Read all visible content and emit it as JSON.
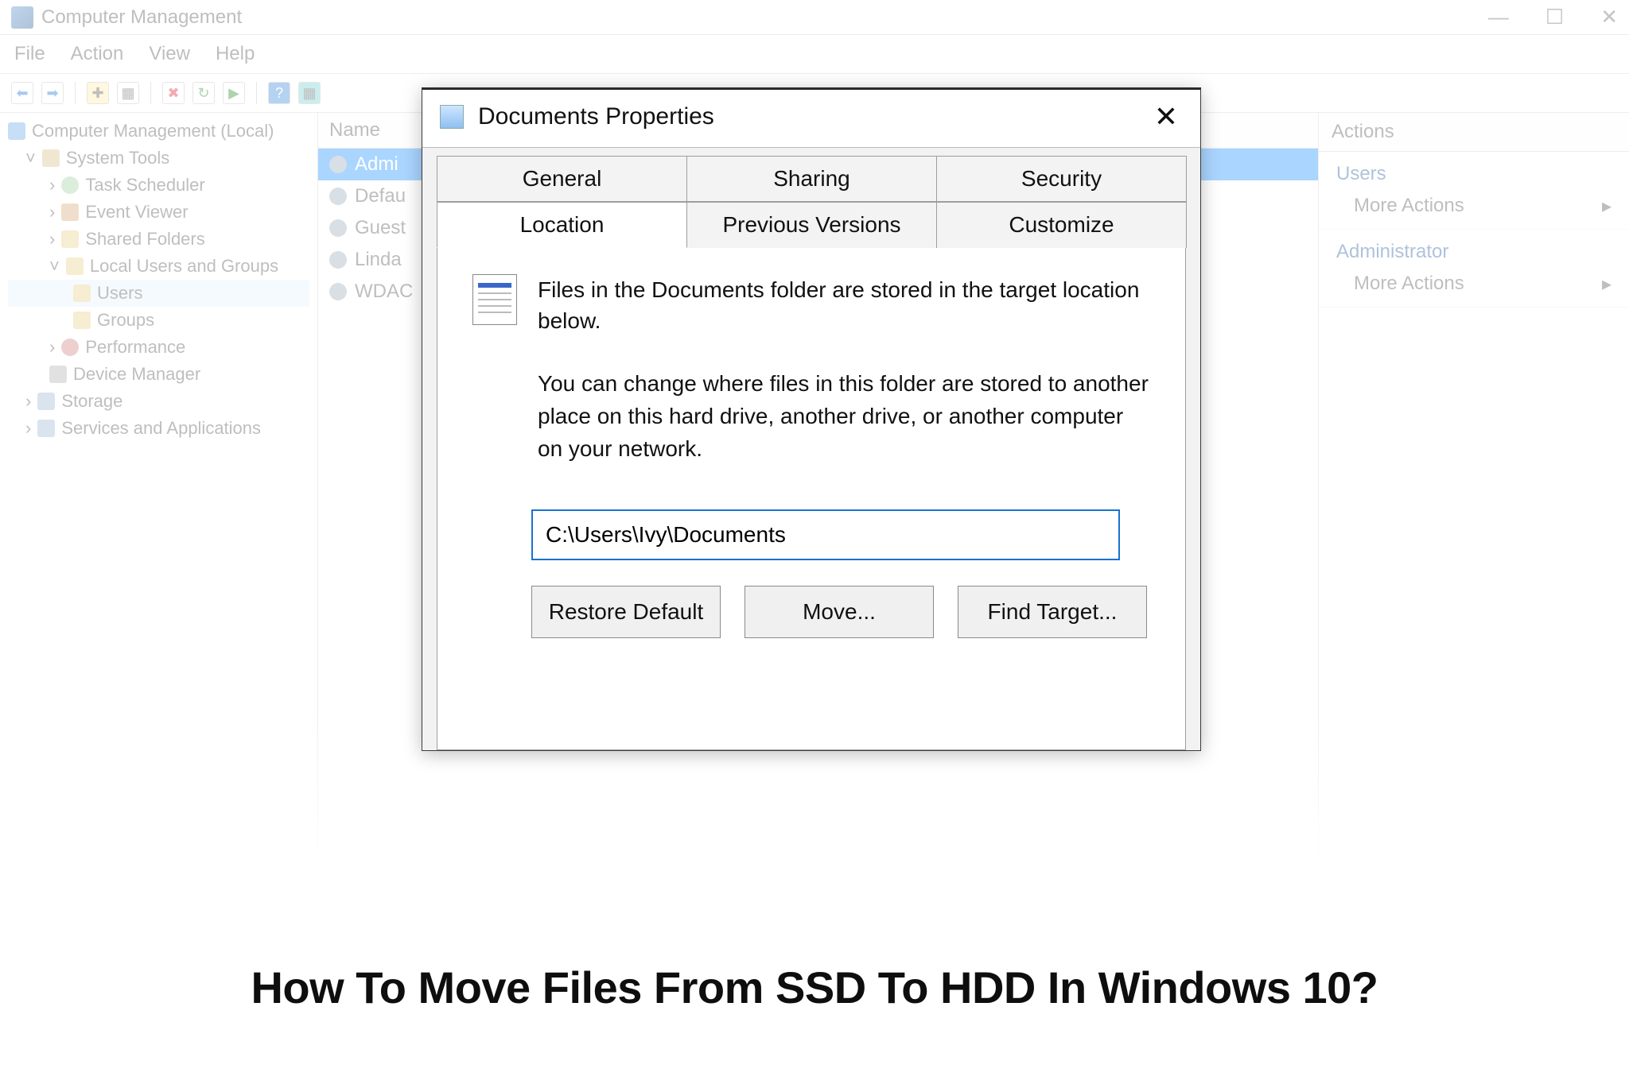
{
  "bg": {
    "title": "Computer Management",
    "menu": [
      "File",
      "Action",
      "View",
      "Help"
    ],
    "winbtns": {
      "min": "—",
      "max": "☐",
      "close": "✕"
    },
    "tree": {
      "root": "Computer Management (Local)",
      "system_tools": "System Tools",
      "task_scheduler": "Task Scheduler",
      "event_viewer": "Event Viewer",
      "shared_folders": "Shared Folders",
      "local_users": "Local Users and Groups",
      "users": "Users",
      "groups": "Groups",
      "performance": "Performance",
      "device_manager": "Device Manager",
      "storage": "Storage",
      "services_apps": "Services and Applications"
    },
    "list": {
      "header": "Name",
      "rows": [
        "Admi",
        "Defau",
        "Guest",
        "Linda",
        "WDAC"
      ]
    },
    "actions": {
      "header": "Actions",
      "users": "Users",
      "more1": "More Actions",
      "admin": "Administrator",
      "more2": "More Actions",
      "chev": "▸"
    }
  },
  "dialog": {
    "title": "Documents Properties",
    "close_glyph": "✕",
    "tabs_top": [
      "General",
      "Sharing",
      "Security"
    ],
    "tabs_bottom": [
      "Location",
      "Previous Versions",
      "Customize"
    ],
    "active_tab": "Location",
    "desc1": "Files in the Documents folder are stored in the target location below.",
    "desc2": "You can change where files in this folder are stored to another place on this hard drive, another drive, or another computer on your network.",
    "path": "C:\\Users\\Ivy\\Documents",
    "btn_restore": "Restore Default",
    "btn_move": "Move...",
    "btn_find": "Find Target..."
  },
  "headline": "How To Move Files From SSD To HDD In Windows 10?"
}
